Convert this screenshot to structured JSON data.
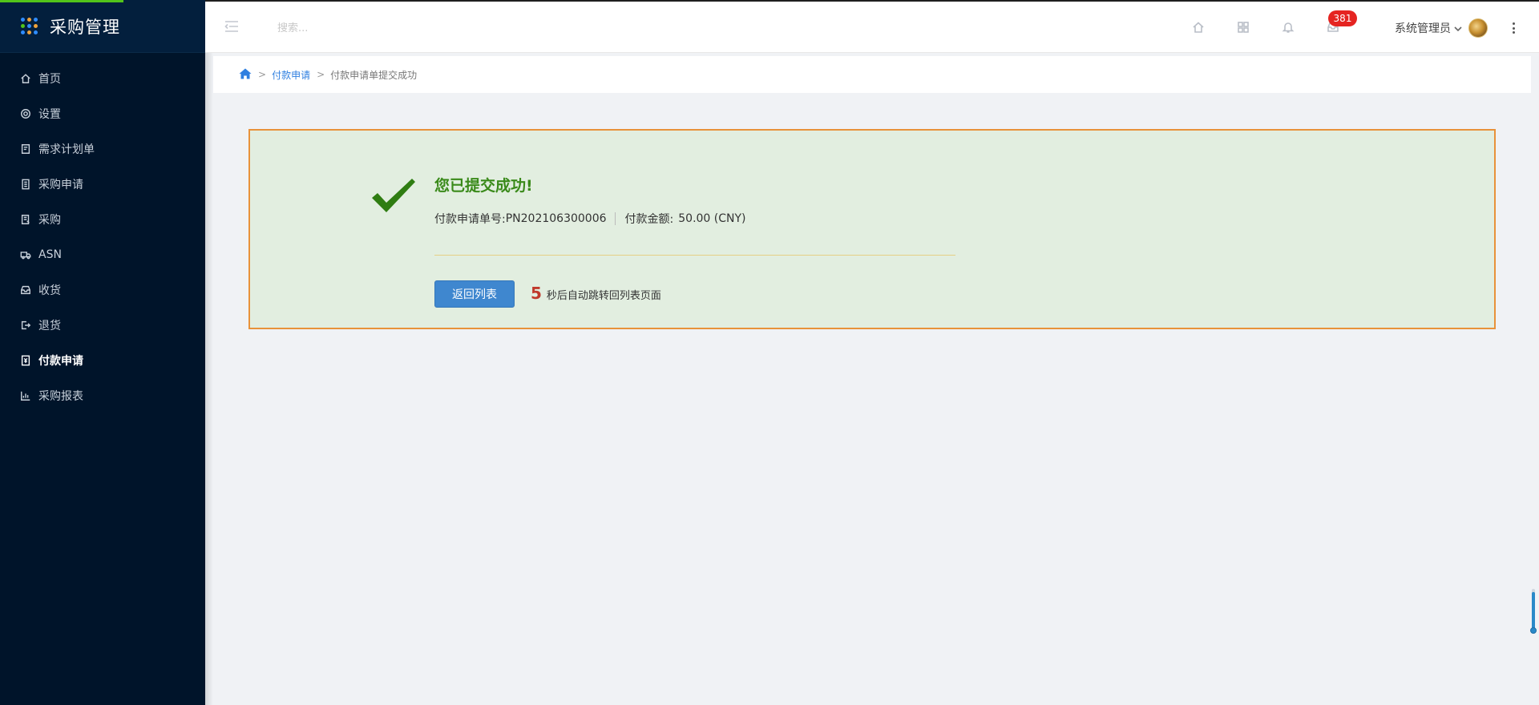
{
  "sidebar": {
    "title": "采购管理",
    "items": [
      {
        "label": "首页",
        "icon": "home-icon"
      },
      {
        "label": "设置",
        "icon": "gear-icon"
      },
      {
        "label": "需求计划单",
        "icon": "plan-icon"
      },
      {
        "label": "采购申请",
        "icon": "request-icon"
      },
      {
        "label": "采购",
        "icon": "purchase-icon"
      },
      {
        "label": "ASN",
        "icon": "truck-icon"
      },
      {
        "label": "收货",
        "icon": "inbox-icon"
      },
      {
        "label": "退货",
        "icon": "exit-icon"
      },
      {
        "label": "付款申请",
        "icon": "payment-icon",
        "active": true
      },
      {
        "label": "采购报表",
        "icon": "chart-icon"
      }
    ]
  },
  "topbar": {
    "search_placeholder": "搜索...",
    "message_badge": "381",
    "user_name": "系统管理员"
  },
  "breadcrumb": {
    "link": "付款申请",
    "current": "付款申请单提交成功"
  },
  "success": {
    "title": "您已提交成功!",
    "order_label": "付款申请单号:",
    "order_number": "PN202106300006",
    "amount_label": "付款金额:",
    "amount_value": "50.00 (CNY)",
    "back_button": "返回列表",
    "countdown_seconds": "5",
    "countdown_text": "秒后自动跳转回列表页面"
  },
  "colors": {
    "sidebar_bg": "#00142a",
    "accent_blue": "#3f87cf",
    "success_green": "#3a8a1a",
    "box_border": "#e8923a",
    "badge_red": "#e52421"
  }
}
